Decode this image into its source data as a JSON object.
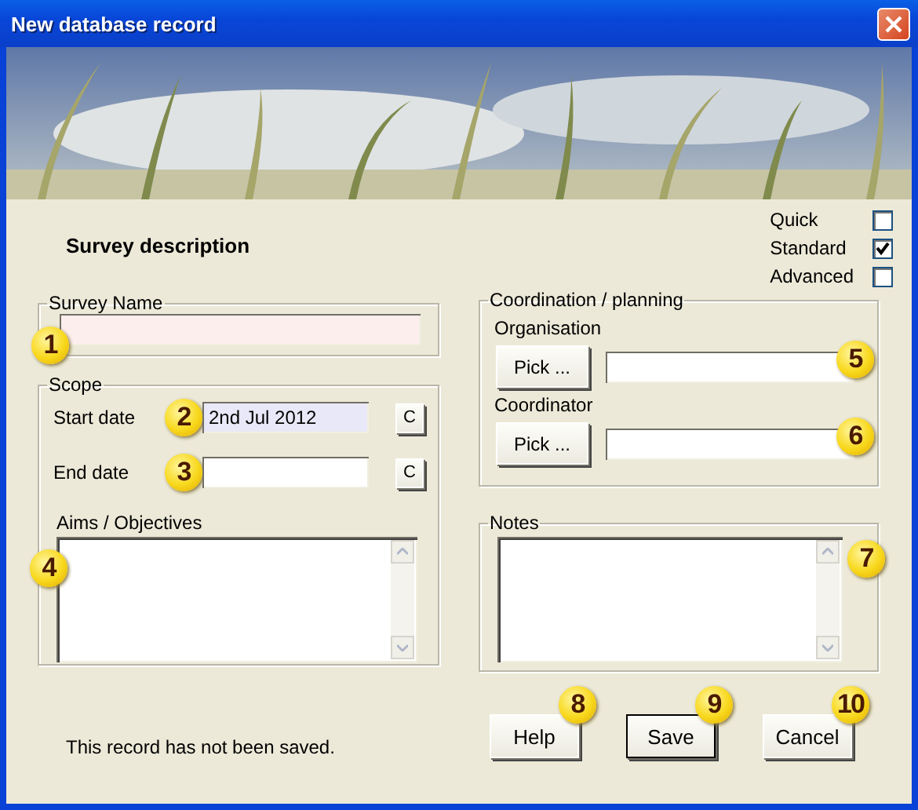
{
  "window": {
    "title": "New database record"
  },
  "heading": "Survey description",
  "modes": [
    {
      "label": "Quick",
      "checked": false
    },
    {
      "label": "Standard",
      "checked": true
    },
    {
      "label": "Advanced",
      "checked": false
    }
  ],
  "survey_name": {
    "legend": "Survey Name",
    "callout": "1"
  },
  "scope": {
    "legend": "Scope",
    "dates": [
      {
        "label": "Start date",
        "value": "2nd Jul 2012",
        "button": "C",
        "callout": "2"
      },
      {
        "label": "End date",
        "button": "C",
        "callout": "3"
      }
    ],
    "aims": {
      "label": "Aims / Objectives",
      "callout": "4"
    }
  },
  "coordination": {
    "legend": "Coordination / planning",
    "fields": [
      {
        "label": "Organisation",
        "button": "Pick ...",
        "callout": "5"
      },
      {
        "label": "Coordinator",
        "button": "Pick ...",
        "callout": "6"
      }
    ]
  },
  "notes": {
    "legend": "Notes",
    "callout": "7"
  },
  "status": "This record has not been saved.",
  "buttons": [
    {
      "label": "Help",
      "callout": "8",
      "default": false
    },
    {
      "label": "Save",
      "callout": "9",
      "default": true
    },
    {
      "label": "Cancel",
      "callout": "10",
      "default": false
    }
  ]
}
